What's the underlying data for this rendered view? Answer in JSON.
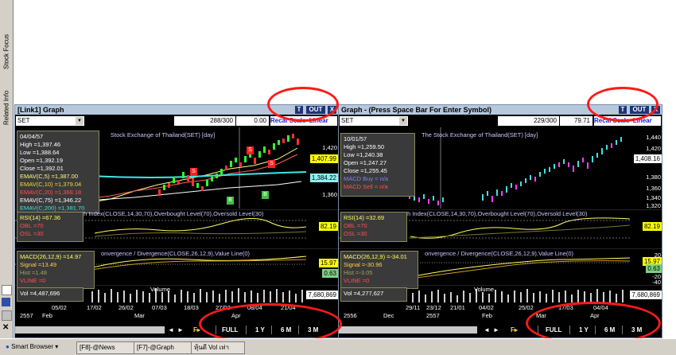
{
  "sidebar": {
    "tabs": [
      "Stock Focus",
      "Related Info"
    ]
  },
  "left_panel": {
    "title": "[Link1] Graph",
    "buttons": [
      "T",
      "OUT",
      "X"
    ],
    "symbol": "SET",
    "count": "288/300",
    "value": "0.00",
    "recal": "Recal Scale",
    "scale_mode": "Linear",
    "chart_title": "Stock Exchange of Thailand(SET) [day]",
    "info": [
      "04/04/57",
      "High =1,397.46",
      "Low =1,388.64",
      "Open =1,392.19",
      "Close =1,392.01",
      "EMAV(C,5) =1,387.00",
      "EMAV(C,10) =1,379.04",
      "EMAV(C,20) =1,368.18",
      "EMAV(C,75) =1,346.22",
      "EMAV(C,200) =1,381.70"
    ],
    "price_ticks": [
      "1,420",
      "1,407.99",
      "1,384.22",
      "1,360"
    ],
    "rsi_title": "th Index(CLOSE,14,30,70),Overbought Level(70),Oversold Level(30)",
    "rsi_info": [
      "RSI(14) =67.36",
      "OBL =70",
      "OSL =30"
    ],
    "rsi_badge": "82.19",
    "macd_title": "onvergence / Divergence(CLOSE,26,12,9),Value Line(0)",
    "macd_info": [
      "MACD(26,12,9) =14.97",
      "Signal =13.49",
      "Hist =1.48",
      "VLINE =0"
    ],
    "macd_badges": [
      "15.97",
      "0.63"
    ],
    "volume_label": "Volume",
    "vol_info": "Vol =4,487,696",
    "vol_badge": "7,680,869",
    "x_dates": [
      "05/02",
      "17/02",
      "26/02",
      "07/03",
      "18/03",
      "27/03",
      "08/04",
      "21/04"
    ],
    "x_months": [
      "2557",
      "Feb",
      "Mar",
      "Apr"
    ],
    "nav": [
      "FULL",
      "1 Y",
      "6 M",
      "3 M"
    ],
    "markers": [
      "S",
      "S",
      "S",
      "B",
      "B"
    ]
  },
  "right_panel": {
    "title": "Graph  - (Press Space Bar For Enter Symbol)",
    "buttons": [
      "T",
      "OUT",
      "X"
    ],
    "symbol": "SET",
    "count": "229/300",
    "value": "79.71",
    "recal": "Recal Scale",
    "scale_mode": "Linear",
    "chart_title": "The Stock Exchange of Thailand(SET) [day]",
    "info": [
      "10/01/57",
      "High =1,259.50",
      "Low =1,240.38",
      "Open =1,247.27",
      "Close =1,255.45",
      "MACD Buy = n/a",
      "MACD Sell = n/a"
    ],
    "price_ticks": [
      "1,440",
      "1,420",
      "1,408.16",
      "1,380",
      "1,360",
      "1,340",
      "1,320"
    ],
    "rsi_title": "th Index(CLOSE,14,30,70),Overbought Level(70),Oversold Level(30)",
    "rsi_info": [
      "RSI(14) =32.69",
      "OBL =70",
      "OSL =30"
    ],
    "rsi_badge": "82.19",
    "macd_title": "onvergence / Divergence(CLOSE,26,12,9),Value Line(0)",
    "macd_info": [
      "MACD(26,12,9) =-34.01",
      "Signal =-30.96",
      "Hist =-3.05",
      "VLINE =0"
    ],
    "macd_badges": [
      "15.97",
      "0.63"
    ],
    "macd_ticks": [
      "20",
      "0",
      "-20",
      "-40"
    ],
    "volume_label": "Volume",
    "vol_info": "Vol =4,277,627",
    "vol_badge": "7,680,869",
    "x_dates": [
      "29/11",
      "23/12",
      "21/01",
      "04/02",
      "25/02",
      "17/03",
      "04/04"
    ],
    "x_months": [
      "2556",
      "Dec",
      "2557",
      "Feb",
      "Mar",
      "Apr"
    ],
    "nav": [
      "FULL",
      "1 Y",
      "6 M",
      "3 M"
    ]
  },
  "taskbar": {
    "items": [
      "Smart Browser",
      "[F8]-@News",
      "[F7]-@Graph",
      "หุ้นดี Vol เท่า"
    ]
  },
  "colors": {
    "annotation": "#ff1a1a",
    "titlebar": "#b7c8dc",
    "button": "#1e3478",
    "badge": "#ffff00"
  }
}
